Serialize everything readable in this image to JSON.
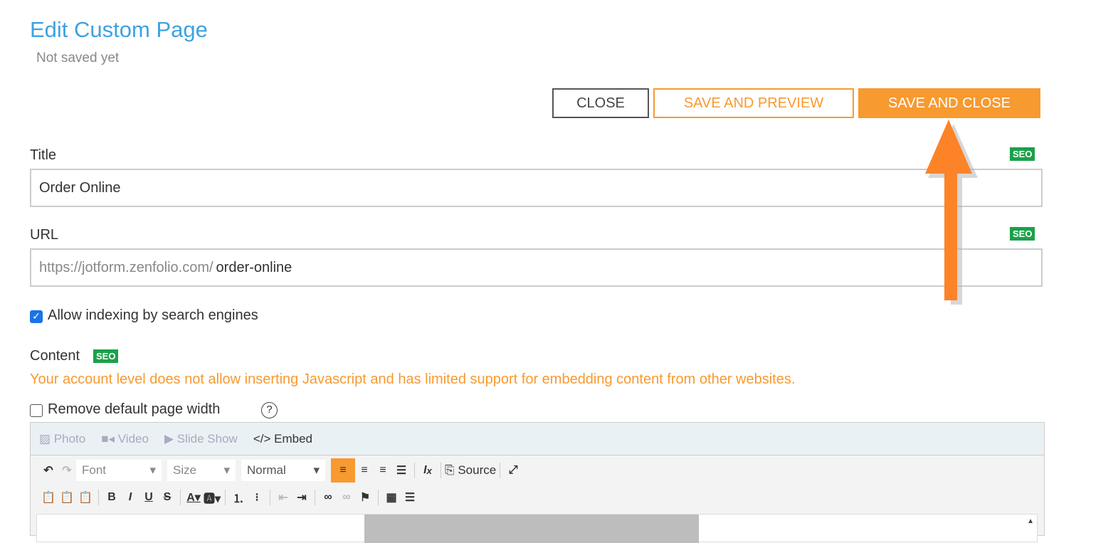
{
  "header": {
    "title": "Edit Custom Page",
    "status": "Not saved yet"
  },
  "buttons": {
    "close": "CLOSE",
    "save_preview": "SAVE AND PREVIEW",
    "save_close": "SAVE AND CLOSE"
  },
  "form": {
    "title_label": "Title",
    "title_value": "Order Online",
    "seo": "SEO",
    "url_label": "URL",
    "url_prefix": "https://jotform.zenfolio.com/",
    "url_value": "order-online",
    "indexing_label": "Allow indexing by search engines",
    "indexing_checked": true,
    "content_label": "Content",
    "warning": "Your account level does not allow inserting Javascript and has limited support for embedding content from other websites.",
    "remove_width_label": "Remove default page width",
    "help": "?"
  },
  "editor": {
    "media": [
      "Photo",
      "Video",
      "Slide Show",
      "Embed"
    ],
    "font": "Font",
    "size": "Size",
    "format": "Normal",
    "source": "Source"
  },
  "colors": {
    "accent": "#f79a30",
    "title": "#3fa2e0",
    "seo": "#1aa14a",
    "arrow": "#fd8328"
  }
}
